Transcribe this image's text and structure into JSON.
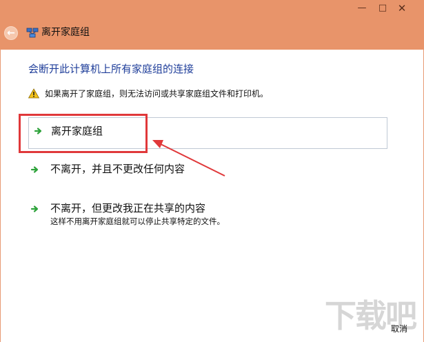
{
  "window": {
    "title": "离开家庭组",
    "controls": {
      "minimize": "—",
      "maximize": "□",
      "close": "✕"
    },
    "accent": "#e8946a"
  },
  "content": {
    "heading": "会断开此计算机上所有家庭组的连接",
    "warning": "如果离开了家庭组，则无法访问或共享家庭组文件和打印机。",
    "options": [
      {
        "title": "离开家庭组",
        "description": ""
      },
      {
        "title": "不离开，并且不更改任何内容",
        "description": ""
      },
      {
        "title": "不离开，但更改我正在共享的内容",
        "description": "这样不用离开家庭组就可以停止共享特定的文件。"
      }
    ],
    "cancel_label": "取消",
    "watermark": "下载吧"
  },
  "icons": {
    "back": "back-arrow-icon",
    "homegroup": "homegroup-network-icon",
    "warning": "warning-triangle-icon",
    "option": "green-arrow-icon"
  }
}
